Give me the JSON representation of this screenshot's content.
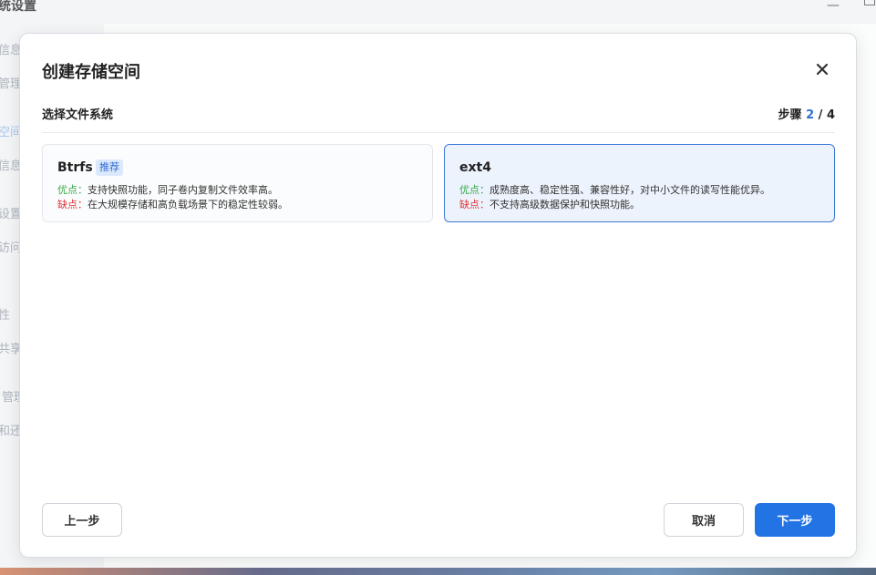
{
  "background": {
    "window_title": "统设置",
    "sidebar_fragments": [
      "信息",
      "管理",
      "空间",
      "信息",
      "设置",
      "访问",
      "性",
      "共享",
      "管理",
      "和还"
    ],
    "active_index": 2
  },
  "dialog": {
    "title": "创建存储空间",
    "section_label": "选择文件系统",
    "step_prefix": "步骤",
    "step_current": "2",
    "step_separator": "/",
    "step_total": "4",
    "options": [
      {
        "name": "Btrfs",
        "badge": "推荐",
        "pro_label": "优点：",
        "pro_text": "支持快照功能，同子卷内复制文件效率高。",
        "con_label": "缺点：",
        "con_text": "在大规模存储和高负载场景下的稳定性较弱。",
        "selected": false
      },
      {
        "name": "ext4",
        "badge": "",
        "pro_label": "优点：",
        "pro_text": "成熟度高、稳定性强、兼容性好，对中小文件的读写性能优异。",
        "con_label": "缺点：",
        "con_text": "不支持高级数据保护和快照功能。",
        "selected": true
      }
    ],
    "buttons": {
      "prev": "上一步",
      "cancel": "取消",
      "next": "下一步"
    }
  },
  "colors": {
    "accent": "#2273e3",
    "pro": "#3aa64a",
    "con": "#e0363a",
    "selected_border": "#3a78d8"
  },
  "icons": {
    "close": "close-icon",
    "minimize": "minimize-icon",
    "maximize": "maximize-icon"
  }
}
